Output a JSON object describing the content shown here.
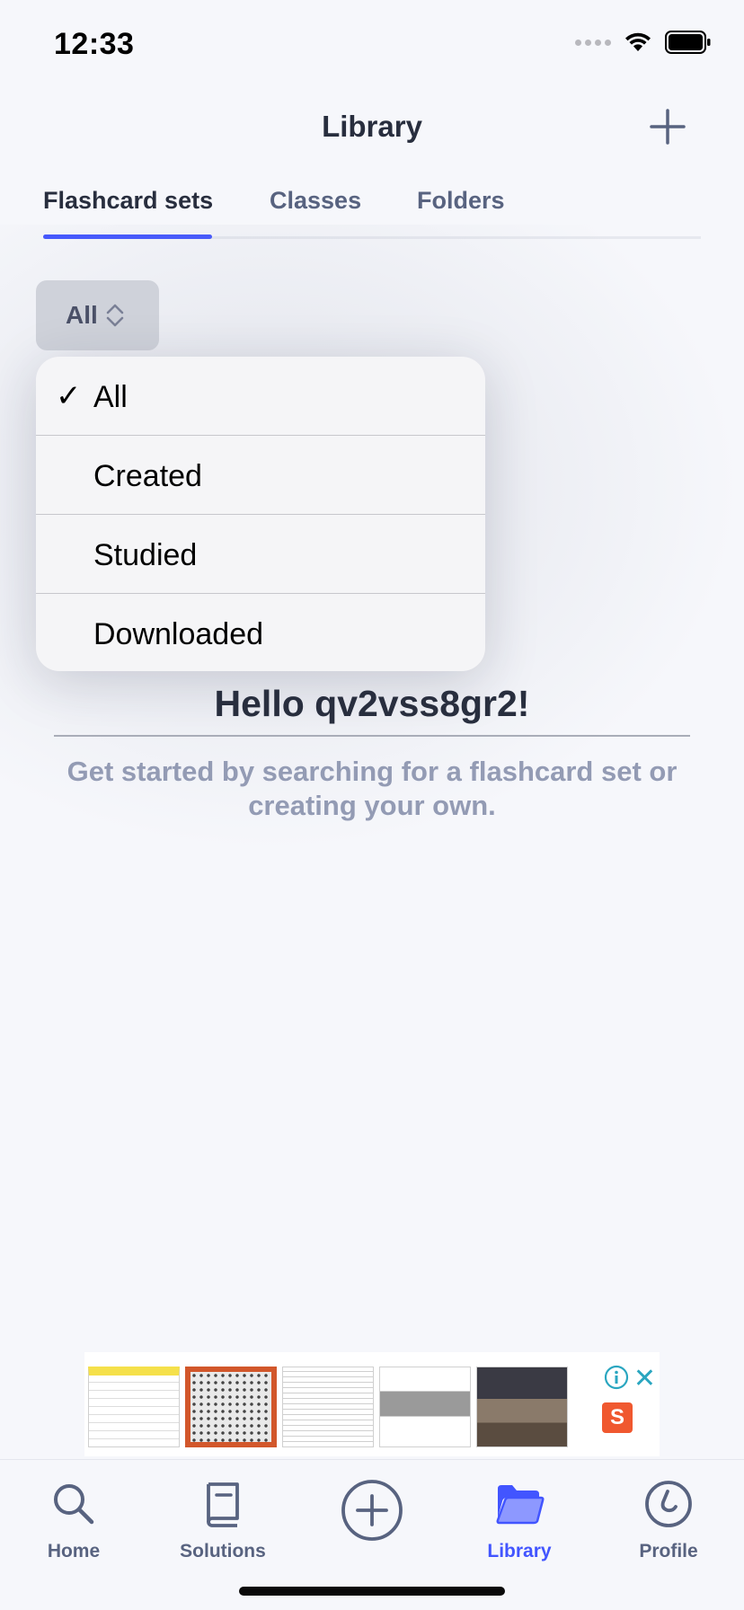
{
  "status_bar": {
    "time": "12:33"
  },
  "header": {
    "title": "Library"
  },
  "tabs": [
    {
      "label": "Flashcard sets",
      "active": true
    },
    {
      "label": "Classes",
      "active": false
    },
    {
      "label": "Folders",
      "active": false
    }
  ],
  "filter": {
    "selected": "All",
    "options": [
      {
        "label": "All",
        "checked": true
      },
      {
        "label": "Created",
        "checked": false
      },
      {
        "label": "Studied",
        "checked": false
      },
      {
        "label": "Downloaded",
        "checked": false
      }
    ],
    "check_glyph": "✓"
  },
  "empty_state": {
    "greeting": "Hello qv2vss8gr2!",
    "hint": "Get started by searching for a flashcard set or creating your own."
  },
  "ad": {
    "shop_badge": "S",
    "close_glyph": "✕"
  },
  "tabbar": [
    {
      "label": "Home",
      "icon": "search-icon",
      "active": false
    },
    {
      "label": "Solutions",
      "icon": "book-icon",
      "active": false
    },
    {
      "label": "",
      "icon": "add-circle-icon",
      "active": false
    },
    {
      "label": "Library",
      "icon": "folder-icon",
      "active": true
    },
    {
      "label": "Profile",
      "icon": "profile-icon",
      "active": false
    }
  ],
  "colors": {
    "accent": "#4255ff",
    "text": "#282e3e",
    "muted": "#586380",
    "hint": "#939bb4"
  }
}
